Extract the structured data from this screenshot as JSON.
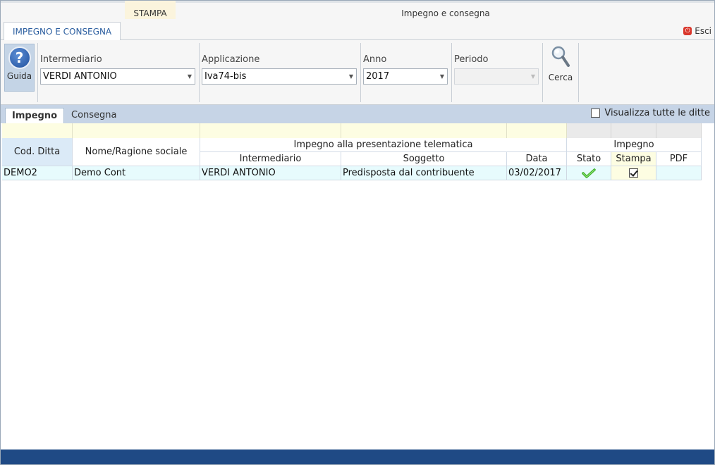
{
  "window": {
    "title": "Impegno e consegna"
  },
  "ribbon": {
    "tabs": [
      {
        "label": "IMPEGNO E CONSEGNA"
      },
      {
        "label": "STAMPA"
      }
    ],
    "exit_label": "Esci"
  },
  "toolbar": {
    "help_label": "Guida",
    "intermediario": {
      "label": "Intermediario",
      "value": "VERDI ANTONIO"
    },
    "applicazione": {
      "label": "Applicazione",
      "value": "Iva74-bis"
    },
    "anno": {
      "label": "Anno",
      "value": "2017"
    },
    "periodo": {
      "label": "Periodo",
      "value": ""
    },
    "search_label": "Cerca"
  },
  "subtabs": {
    "tabs": [
      {
        "label": "Impegno"
      },
      {
        "label": "Consegna"
      }
    ],
    "show_all_label": "Visualizza tutte le ditte",
    "show_all_checked": false
  },
  "grid": {
    "group_headers": {
      "telematica": "Impegno alla presentazione telematica",
      "impegno": "Impegno"
    },
    "columns": {
      "cod_ditta": "Cod. Ditta",
      "nome": "Nome/Ragione sociale",
      "intermediario": "Intermediario",
      "soggetto": "Soggetto",
      "data": "Data",
      "stato": "Stato",
      "stampa": "Stampa",
      "pdf": "PDF"
    },
    "rows": [
      {
        "cod_ditta": "DEMO2",
        "nome": "Demo Cont",
        "intermediario": "VERDI ANTONIO",
        "soggetto": "Predisposta dal contribuente",
        "data": "03/02/2017",
        "stato_icon": "green-check-icon",
        "stampa_checked": true,
        "pdf": ""
      }
    ]
  },
  "colors": {
    "accent": "#2a5d9f",
    "subtab_bar": "#c6d4e6",
    "row_highlight": "#e7fbfd",
    "filter_row": "#fdfde2",
    "status_bar": "#1f4a85",
    "stampa_tab": "#f0a033"
  }
}
